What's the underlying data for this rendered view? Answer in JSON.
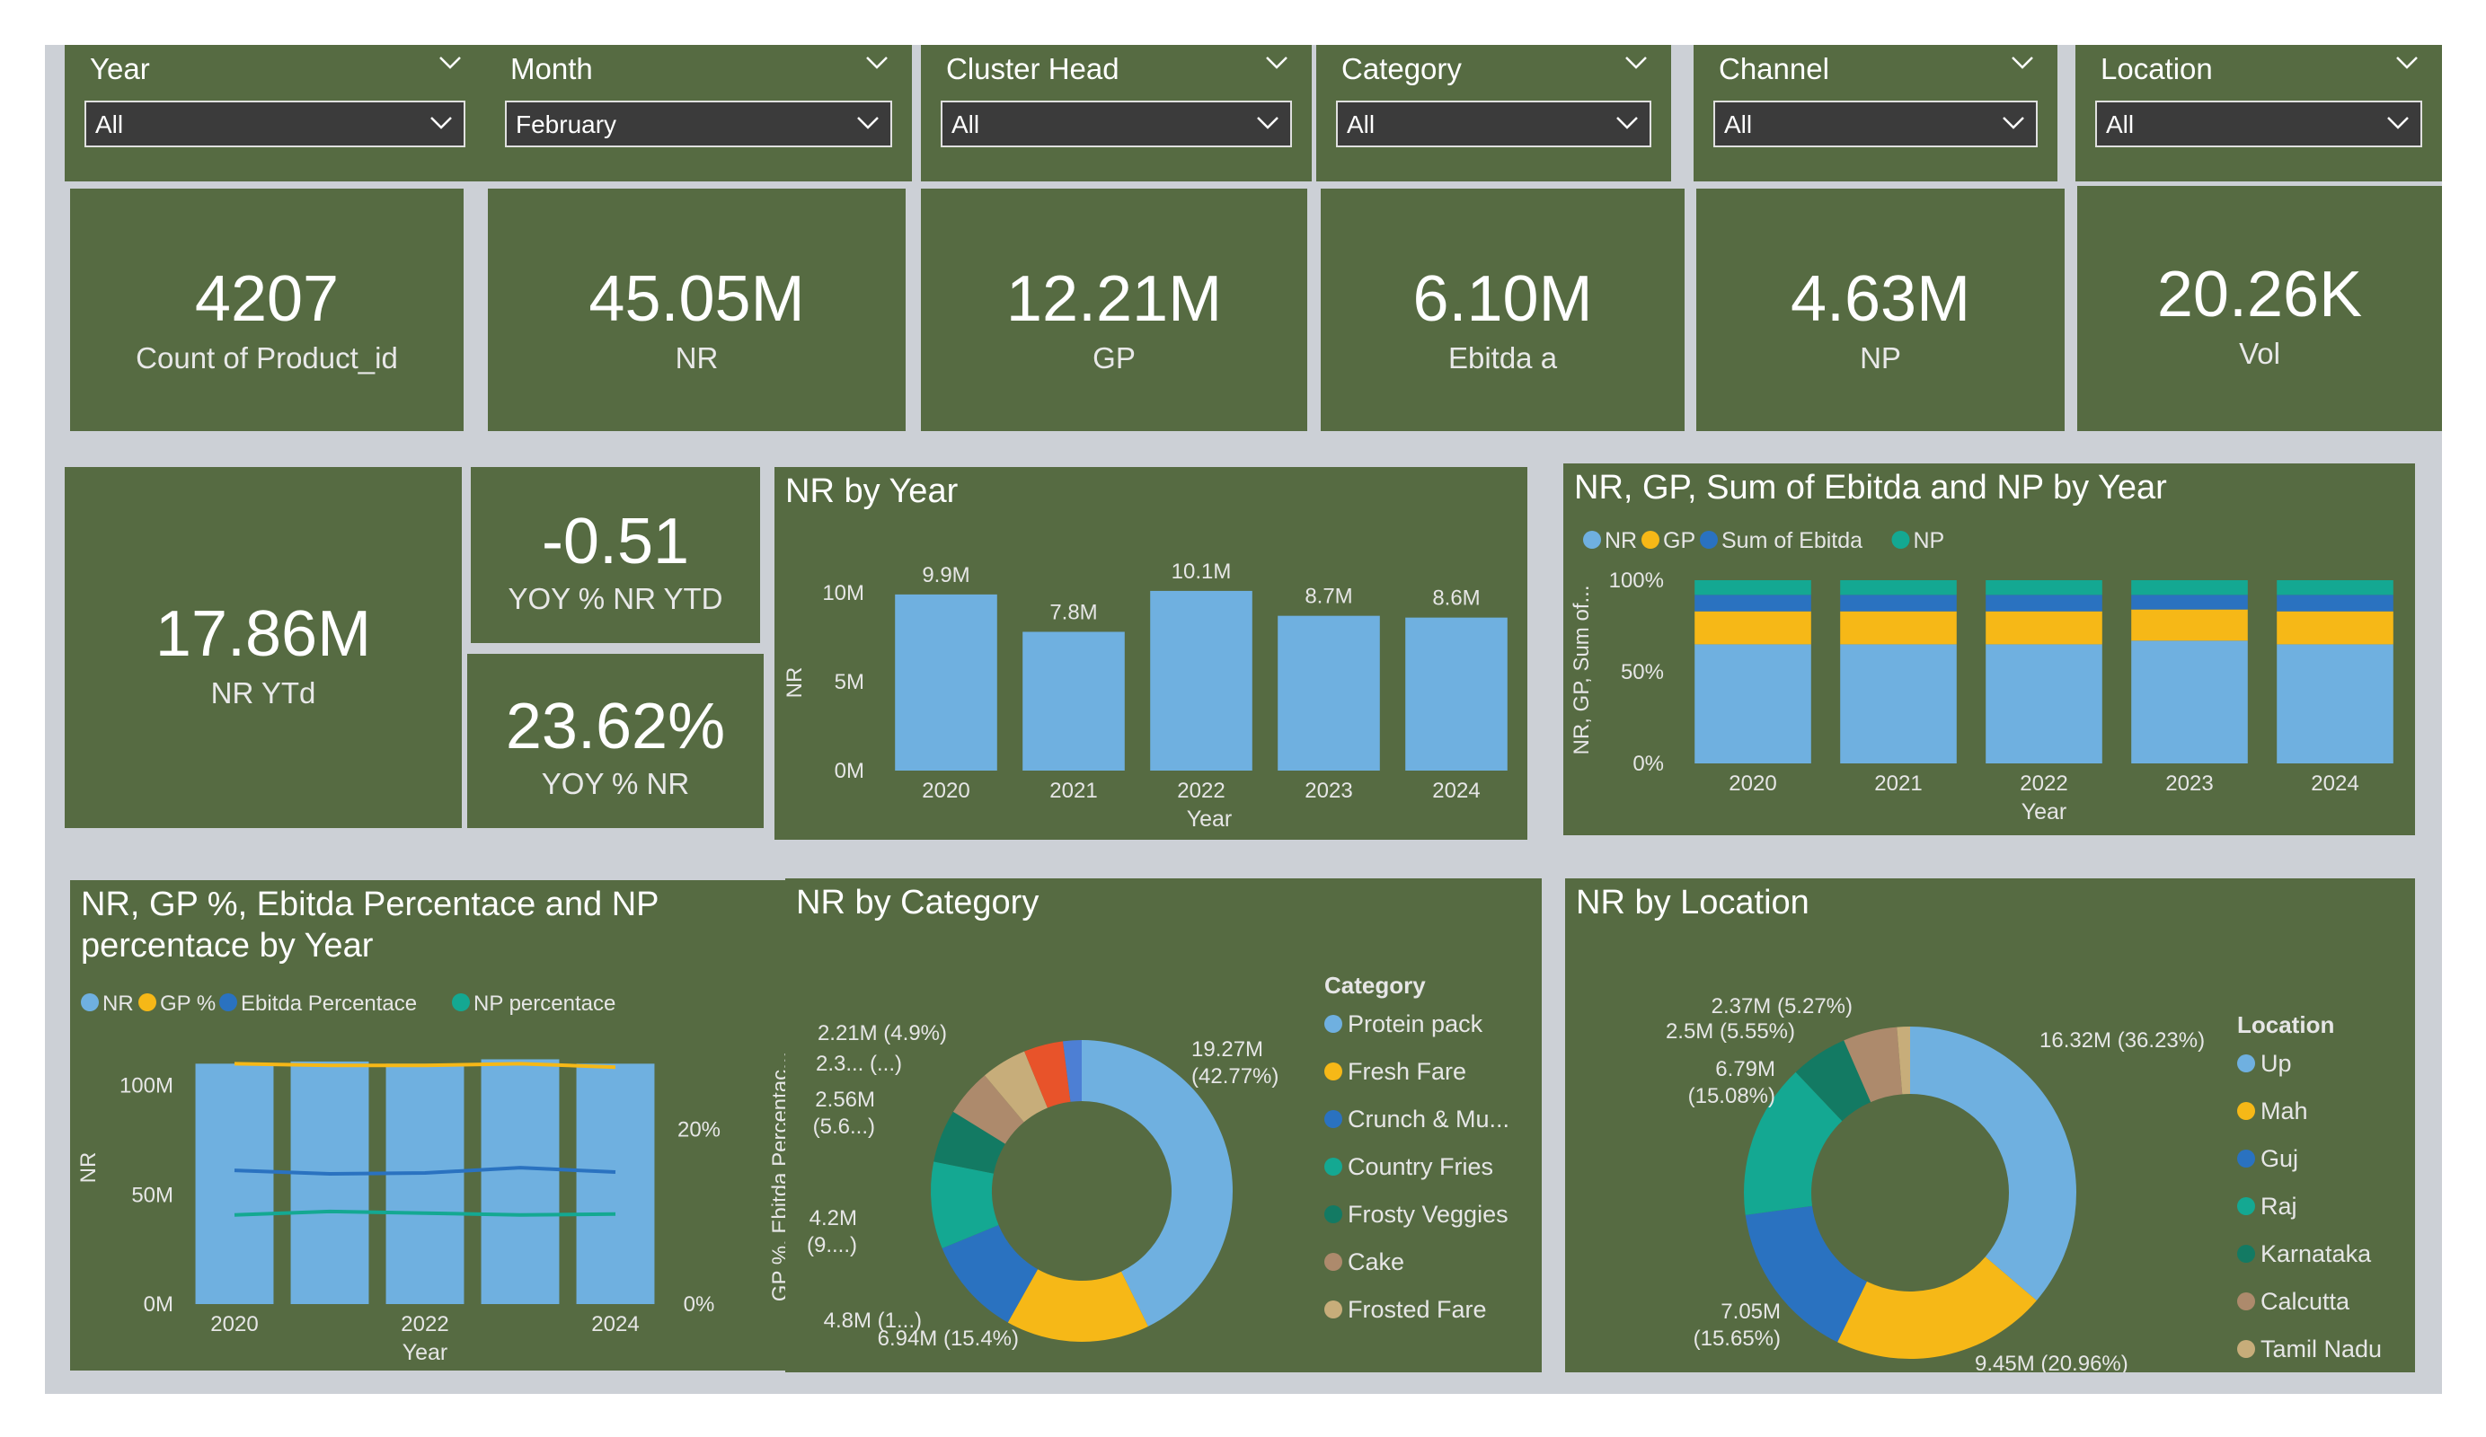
{
  "slicers": [
    {
      "title": "Year",
      "value": "All"
    },
    {
      "title": "Month",
      "value": "February"
    },
    {
      "title": "Cluster Head",
      "value": "All"
    },
    {
      "title": "Category",
      "value": "All"
    },
    {
      "title": "Channel",
      "value": "All"
    },
    {
      "title": "Location",
      "value": "All"
    }
  ],
  "kpis": [
    {
      "value": "4207",
      "label": "Count of Product_id"
    },
    {
      "value": "45.05M",
      "label": "NR"
    },
    {
      "value": "12.21M",
      "label": "GP"
    },
    {
      "value": "6.10M",
      "label": "Ebitda a"
    },
    {
      "value": "4.63M",
      "label": "NP"
    },
    {
      "value": "20.26K",
      "label": "Vol"
    }
  ],
  "kpi_ytd": {
    "value": "17.86M",
    "label": "NR YTd"
  },
  "kpi_yoy_ytd": {
    "value": "-0.51",
    "label": "YOY % NR YTD"
  },
  "kpi_yoy": {
    "value": "23.62%",
    "label": "YOY % NR"
  },
  "colors": {
    "panel": "#566b42",
    "canvas": "#ccd0d6",
    "nr": "#6fb0e0",
    "gp": "#f6b817",
    "ebitda": "#2a72c0",
    "np": "#14a892",
    "frosty": "#137a63",
    "cake": "#ad8a6c",
    "frosted": "#c7ad7a",
    "other1": "#e8532a",
    "other2": "#4d7fd4"
  },
  "chart_data": [
    {
      "type": "bar",
      "title": "NR by Year",
      "xlabel": "Year",
      "ylabel": "NR",
      "categories": [
        "2020",
        "2021",
        "2022",
        "2023",
        "2024"
      ],
      "values": [
        9.9,
        7.8,
        10.1,
        8.7,
        8.6
      ],
      "data_labels": [
        "9.9M",
        "7.8M",
        "10.1M",
        "8.7M",
        "8.6M"
      ],
      "yticks": [
        "0M",
        "5M",
        "10M"
      ],
      "ylim": [
        0,
        10.5
      ],
      "unit": "M"
    },
    {
      "type": "bar",
      "stacked": "100%",
      "title": "NR, GP, Sum of Ebitda and NP by Year",
      "xlabel": "Year",
      "ylabel": "NR, GP, Sum of...",
      "categories": [
        "2020",
        "2021",
        "2022",
        "2023",
        "2024"
      ],
      "yticks": [
        "0%",
        "50%",
        "100%"
      ],
      "legend_position": "top-left",
      "series": [
        {
          "name": "NR",
          "values": [
            65,
            65,
            65,
            67,
            65
          ]
        },
        {
          "name": "GP",
          "values": [
            18,
            18,
            18,
            17,
            18
          ]
        },
        {
          "name": "Sum of Ebitda",
          "values": [
            9,
            9,
            9,
            8,
            9
          ]
        },
        {
          "name": "NP",
          "values": [
            8,
            8,
            8,
            8,
            8
          ]
        }
      ]
    },
    {
      "type": "bar+line",
      "title": "NR, GP %, Ebitda Percentace and NP percentace by Year",
      "xlabel": "Year",
      "ylabel": "NR",
      "y2label": "GP %, Ebitda Percentac...",
      "categories": [
        "2020",
        "2021",
        "2022",
        "2023",
        "2024"
      ],
      "x_tick_labels": [
        "2020",
        "",
        "2022",
        "",
        "2024"
      ],
      "yticks": [
        "0M",
        "50M",
        "100M"
      ],
      "y2ticks": [
        "0%",
        "20%"
      ],
      "legend_position": "top-left",
      "series": [
        {
          "name": "NR",
          "values": [
            110,
            111,
            110,
            112,
            110
          ]
        },
        {
          "name": "GP %",
          "values": [
            27.5,
            27.3,
            27.3,
            27.5,
            27.1
          ]
        },
        {
          "name": "Ebitda Percentace",
          "values": [
            15.3,
            14.9,
            15.0,
            15.6,
            15.1
          ]
        },
        {
          "name": "NP percentace",
          "values": [
            10.2,
            10.6,
            10.4,
            10.2,
            10.3
          ]
        }
      ],
      "ylim": [
        0,
        120
      ],
      "y2lim": [
        0,
        30
      ]
    },
    {
      "type": "pie",
      "donut": true,
      "title": "NR by Category",
      "legend_title": "Category",
      "legend_position": "right",
      "slices": [
        {
          "name": "Protein pack",
          "value": 19.27,
          "label": "19.27M\n(42.77%)"
        },
        {
          "name": "Fresh Fare",
          "value": 6.94,
          "label": "6.94M (15.4%)"
        },
        {
          "name": "Crunch & Mu...",
          "value": 4.8,
          "label": "4.8M (1...)"
        },
        {
          "name": "Country Fries",
          "value": 4.2,
          "label": "4.2M\n(9....)"
        },
        {
          "name": "Frosty Veggies",
          "value": 2.56,
          "label": "2.56M\n(5.6...)"
        },
        {
          "name": "Cake",
          "value": 2.3,
          "label": "2.3... (...)"
        },
        {
          "name": "Frosted Fare",
          "value": 2.21,
          "label": "2.21M (4.9%)"
        },
        {
          "name": "",
          "value": 1.9,
          "label": ""
        },
        {
          "name": "",
          "value": 0.9,
          "label": ""
        }
      ]
    },
    {
      "type": "pie",
      "donut": true,
      "title": "NR by Location",
      "legend_title": "Location",
      "legend_position": "right",
      "slices": [
        {
          "name": "Up",
          "value": 16.32,
          "label": "16.32M (36.23%)"
        },
        {
          "name": "Mah",
          "value": 9.45,
          "label": "9.45M (20.96%)"
        },
        {
          "name": "Guj",
          "value": 7.05,
          "label": "7.05M\n(15.65%)"
        },
        {
          "name": "Raj",
          "value": 6.79,
          "label": "6.79M\n(15.08%)"
        },
        {
          "name": "Karnataka",
          "value": 2.5,
          "label": "2.5M (5.55%)"
        },
        {
          "name": "Calcutta",
          "value": 2.37,
          "label": "2.37M (5.27%)"
        },
        {
          "name": "Tamil Nadu",
          "value": 0.57,
          "label": ""
        }
      ]
    }
  ]
}
